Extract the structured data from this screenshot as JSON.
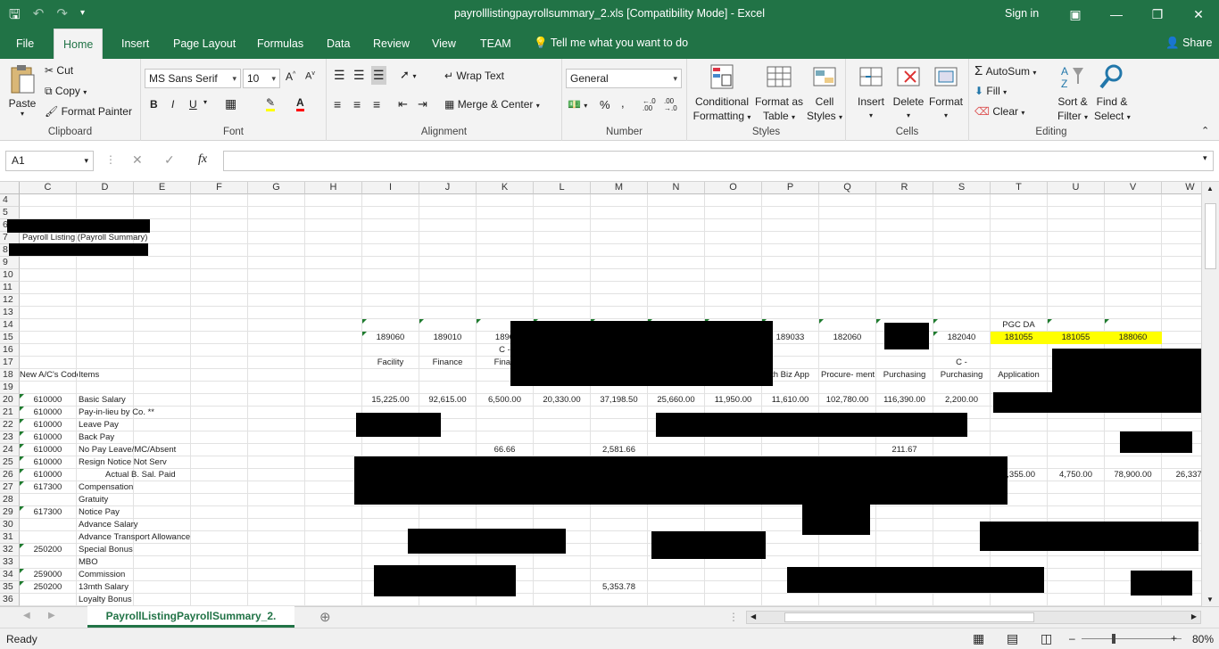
{
  "window": {
    "title": "payrolllistingpayrollsummary_2.xls  [Compatibility Mode]  -  Excel",
    "signin": "Sign in"
  },
  "tabs": [
    "File",
    "Home",
    "Insert",
    "Page Layout",
    "Formulas",
    "Data",
    "Review",
    "View",
    "TEAM"
  ],
  "tell_me": "Tell me what you want to do",
  "share": "Share",
  "ribbon": {
    "clipboard": {
      "label": "Clipboard",
      "paste": "Paste",
      "cut": "Cut",
      "copy": "Copy",
      "format_painter": "Format Painter"
    },
    "font": {
      "label": "Font",
      "name": "MS Sans Serif",
      "size": "10",
      "bold": "B",
      "italic": "I",
      "underline": "U"
    },
    "alignment": {
      "label": "Alignment",
      "wrap": "Wrap Text",
      "merge": "Merge & Center"
    },
    "number": {
      "label": "Number",
      "format": "General",
      "percent": "%",
      "comma": ","
    },
    "styles": {
      "label": "Styles",
      "cond_fmt1": "Conditional",
      "cond_fmt2": "Formatting",
      "fmt_table1": "Format as",
      "fmt_table2": "Table",
      "cell_styles1": "Cell",
      "cell_styles2": "Styles"
    },
    "cells": {
      "label": "Cells",
      "insert": "Insert",
      "delete": "Delete",
      "format": "Format"
    },
    "editing": {
      "label": "Editing",
      "autosum": "AutoSum",
      "fill": "Fill",
      "clear": "Clear",
      "sort1": "Sort &",
      "sort2": "Filter",
      "find1": "Find &",
      "find2": "Select"
    }
  },
  "formula_bar": {
    "name_box": "A1",
    "fx": "fx"
  },
  "columns": [
    "C",
    "D",
    "E",
    "F",
    "G",
    "H",
    "I",
    "J",
    "K",
    "L",
    "M",
    "N",
    "O",
    "P",
    "Q",
    "R",
    "S",
    "T",
    "U",
    "V",
    "W"
  ],
  "rows": [
    "4",
    "5",
    "6",
    "7",
    "8",
    "9",
    "10",
    "11",
    "12",
    "13",
    "14",
    "15",
    "16",
    "17",
    "18",
    "19",
    "20",
    "21",
    "22",
    "23",
    "24",
    "25",
    "26",
    "27",
    "28",
    "29",
    "30",
    "31",
    "32",
    "33",
    "34",
    "35",
    "36"
  ],
  "sheet": {
    "title": "Payroll Listing (Payroll Summary)",
    "hdr_newac": "New A/C's Code",
    "hdr_items": "Items",
    "r14_T": "PGC DA",
    "r15": {
      "I": "189060",
      "J": "189010",
      "K": "1890",
      "P": "189033",
      "Q": "182060",
      "S": "182040",
      "T": "181055",
      "U": "181055",
      "V": "188060"
    },
    "r16_K": "C -",
    "r17": {
      "I": "Facility",
      "J": "Finance",
      "K": "Finan",
      "S": "C -"
    },
    "r18": {
      "P": "th Biz App",
      "Q": "Procure- ment",
      "R": "Purchasing",
      "S": "Purchasing",
      "T": "Application"
    },
    "items": [
      {
        "code": "610000",
        "name": "Basic Salary"
      },
      {
        "code": "610000",
        "name": "Pay-in-lieu by Co. **"
      },
      {
        "code": "610000",
        "name": "Leave Pay"
      },
      {
        "code": "610000",
        "name": "Back Pay"
      },
      {
        "code": "610000",
        "name": "No Pay Leave/MC/Absent"
      },
      {
        "code": "610000",
        "name": "Resign Notice Not Serv"
      },
      {
        "code": "610000",
        "name": "Actual B. Sal. Paid"
      },
      {
        "code": "617300",
        "name": "Compensation"
      },
      {
        "code": "",
        "name": "Gratuity"
      },
      {
        "code": "617300",
        "name": "Notice Pay"
      },
      {
        "code": "",
        "name": "Advance Salary"
      },
      {
        "code": "",
        "name": "Advance Transport Allowance"
      },
      {
        "code": "250200",
        "name": "Special Bonus"
      },
      {
        "code": "",
        "name": "MBO"
      },
      {
        "code": "259000",
        "name": "Commission"
      },
      {
        "code": "250200",
        "name": "13mth Salary"
      },
      {
        "code": "",
        "name": "Loyalty Bonus"
      }
    ],
    "r20": {
      "I": "15,225.00",
      "J": "92,615.00",
      "K": "6,500.00",
      "L": "20,330.00",
      "M": "37,198.50",
      "N": "25,660.00",
      "O": "11,950.00",
      "P": "11,610.00",
      "Q": "102,780.00",
      "R": "116,390.00",
      "S": "2,200.00"
    },
    "r24": {
      "K": "66.66",
      "M": "2,581.66",
      "R": "211.67"
    },
    "r26": {
      "T": "9,355.00",
      "U": "4,750.00",
      "V": "78,900.00",
      "W": "26,337."
    },
    "r35_M": "5,353.78"
  },
  "sheet_tab": "PayrollListingPayrollSummary_2.",
  "status": {
    "ready": "Ready",
    "zoom": "80%"
  }
}
